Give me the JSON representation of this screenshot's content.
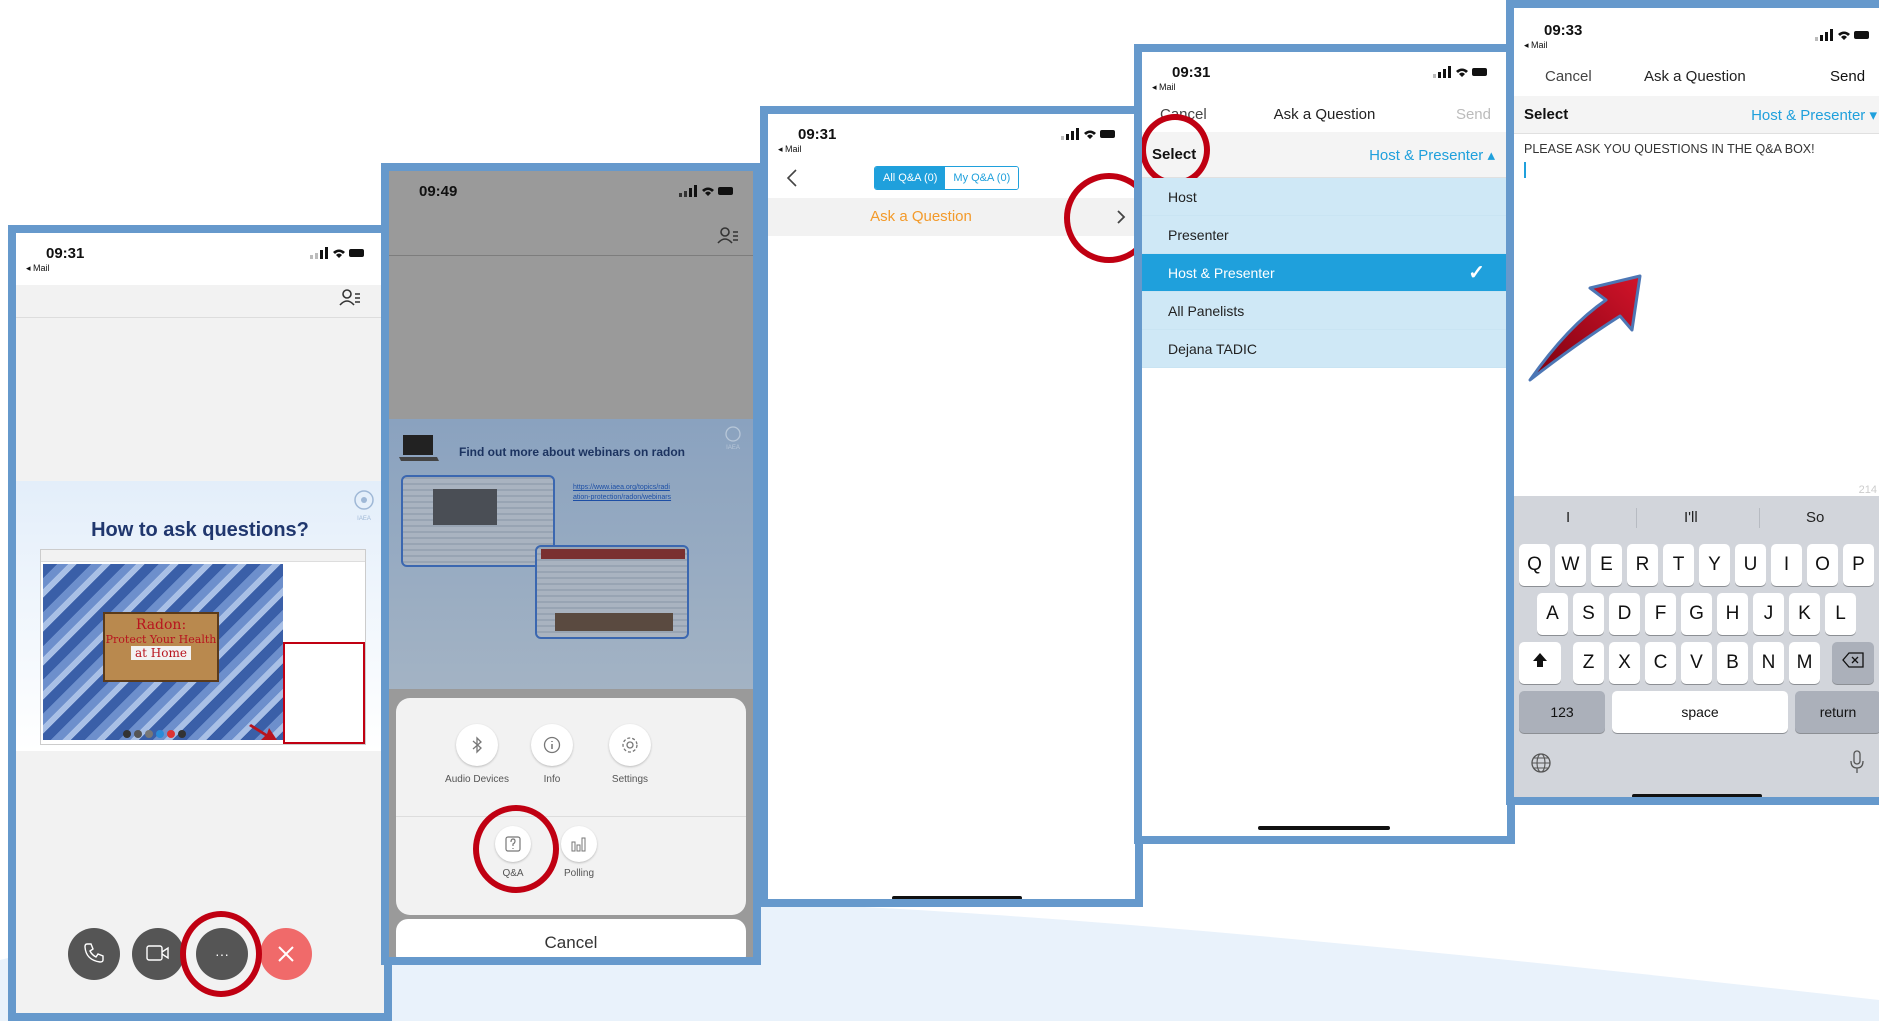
{
  "status_bar": {
    "back_label": "◂ Mail"
  },
  "screen1": {
    "time": "09:31",
    "slide": {
      "title": "How to ask questions?",
      "logo_text": "IAEA",
      "sign_text": [
        "Radon:",
        "Protect Your Health",
        "at Home"
      ]
    },
    "buttons": {
      "more_label": "···"
    }
  },
  "screen2": {
    "time": "09:49",
    "slide": {
      "title": "Find out more about webinars on radon",
      "logo_text": "IAEA",
      "link_text": [
        "https://www.iaea.org/topics/radi",
        "ation-protection/radon/webinars"
      ]
    },
    "menu": {
      "row1": [
        {
          "label": "Audio Devices",
          "icon": "bluetooth-icon"
        },
        {
          "label": "Info",
          "icon": "info-icon"
        },
        {
          "label": "Settings",
          "icon": "gear-icon"
        }
      ],
      "row2": [
        {
          "label": "Q&A",
          "icon": "qa-icon"
        },
        {
          "label": "Polling",
          "icon": "polling-icon"
        }
      ],
      "cancel": "Cancel"
    }
  },
  "screen3": {
    "time": "09:31",
    "tabs": [
      {
        "label": "All Q&A (0)",
        "active": true
      },
      {
        "label": "My Q&A (0)",
        "active": false
      }
    ],
    "ask_question": "Ask a Question"
  },
  "screen4": {
    "time": "09:31",
    "nav": {
      "cancel": "Cancel",
      "title": "Ask a Question",
      "send": "Send"
    },
    "select_label": "Select",
    "selected": "Host & Presenter ▴",
    "options": [
      {
        "label": "Host",
        "selected": false
      },
      {
        "label": "Presenter",
        "selected": false
      },
      {
        "label": "Host & Presenter",
        "selected": true
      },
      {
        "label": "All Panelists",
        "selected": false
      },
      {
        "label": "Dejana TADIC",
        "selected": false
      }
    ],
    "check": "✓"
  },
  "screen5": {
    "time": "09:33",
    "nav": {
      "cancel": "Cancel",
      "title": "Ask a Question",
      "send": "Send"
    },
    "select_label": "Select",
    "selected": "Host & Presenter ▾",
    "text": "PLEASE ASK YOU QUESTIONS IN THE Q&A BOX!",
    "char_count": "214",
    "suggestions": [
      "I",
      "I'll",
      "So"
    ],
    "keys_row1": [
      "Q",
      "W",
      "E",
      "R",
      "T",
      "Y",
      "U",
      "I",
      "O",
      "P"
    ],
    "keys_row2": [
      "A",
      "S",
      "D",
      "F",
      "G",
      "H",
      "J",
      "K",
      "L"
    ],
    "keys_row3": [
      "Z",
      "X",
      "C",
      "V",
      "B",
      "N",
      "M"
    ],
    "key_123": "123",
    "key_space": "space",
    "key_return": "return"
  },
  "colors": {
    "frame": "#6699cc",
    "accent_blue": "#1fa0dc",
    "orange": "#f39a2a",
    "red_ring": "#c00012"
  }
}
